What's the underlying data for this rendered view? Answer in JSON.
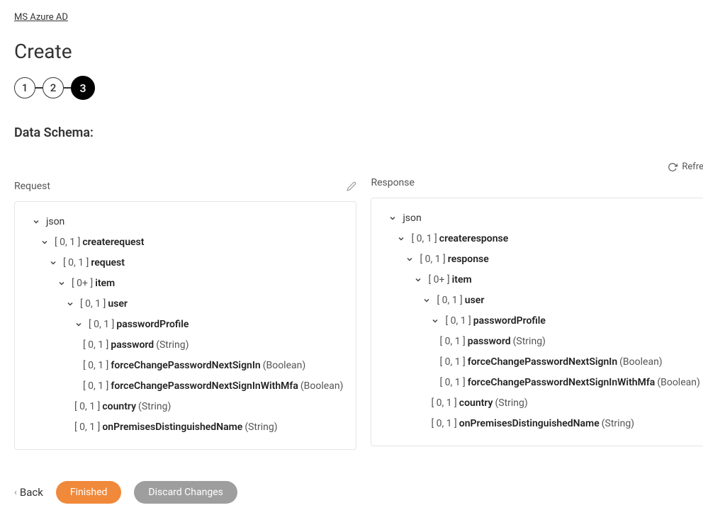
{
  "breadcrumb": "MS Azure AD",
  "pageTitle": "Create",
  "stepper": {
    "step1": "1",
    "step2": "2",
    "step3": "3"
  },
  "sectionTitle": "Data Schema:",
  "refreshLabel": "Refresh",
  "request": {
    "label": "Request",
    "root": "json",
    "n1_card": "[ 0, 1 ]",
    "n1_name": "createrequest",
    "n2_card": "[ 0, 1 ]",
    "n2_name": "request",
    "n3_card": "[ 0+ ]",
    "n3_name": "item",
    "n4_card": "[ 0, 1 ]",
    "n4_name": "user",
    "n5_card": "[ 0, 1 ]",
    "n5_name": "passwordProfile",
    "n6_card": "[ 0, 1 ]",
    "n6_name": "password",
    "n6_type": "(String)",
    "n7_card": "[ 0, 1 ]",
    "n7_name": "forceChangePasswordNextSignIn",
    "n7_type": "(Boolean)",
    "n8_card": "[ 0, 1 ]",
    "n8_name": "forceChangePasswordNextSignInWithMfa",
    "n8_type": "(Boolean)",
    "n9_card": "[ 0, 1 ]",
    "n9_name": "country",
    "n9_type": "(String)",
    "n10_card": "[ 0, 1 ]",
    "n10_name": "onPremisesDistinguishedName",
    "n10_type": "(String)"
  },
  "response": {
    "label": "Response",
    "root": "json",
    "n1_card": "[ 0, 1 ]",
    "n1_name": "createresponse",
    "n2_card": "[ 0, 1 ]",
    "n2_name": "response",
    "n3_card": "[ 0+ ]",
    "n3_name": "item",
    "n4_card": "[ 0, 1 ]",
    "n4_name": "user",
    "n5_card": "[ 0, 1 ]",
    "n5_name": "passwordProfile",
    "n6_card": "[ 0, 1 ]",
    "n6_name": "password",
    "n6_type": "(String)",
    "n7_card": "[ 0, 1 ]",
    "n7_name": "forceChangePasswordNextSignIn",
    "n7_type": "(Boolean)",
    "n8_card": "[ 0, 1 ]",
    "n8_name": "forceChangePasswordNextSignInWithMfa",
    "n8_type": "(Boolean)",
    "n9_card": "[ 0, 1 ]",
    "n9_name": "country",
    "n9_type": "(String)",
    "n10_card": "[ 0, 1 ]",
    "n10_name": "onPremisesDistinguishedName",
    "n10_type": "(String)"
  },
  "footer": {
    "back": "Back",
    "finished": "Finished",
    "discard": "Discard Changes"
  }
}
